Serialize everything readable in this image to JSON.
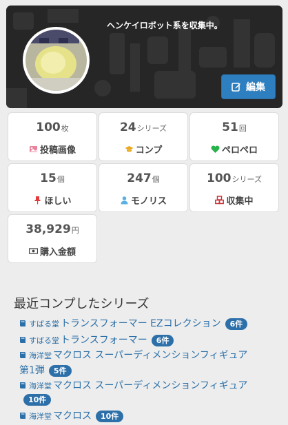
{
  "profile": {
    "bio": "ヘンケイロボット系を収集中。",
    "edit_label": "編集"
  },
  "stats": [
    {
      "value": "100",
      "unit": "枚",
      "label": "投稿画像",
      "icon": "image-icon",
      "icon_color": "#e9839b"
    },
    {
      "value": "24",
      "unit": "シリーズ",
      "label": "コンプ",
      "icon": "graduation-cap-icon",
      "icon_color": "#e8a91e"
    },
    {
      "value": "51",
      "unit": "回",
      "label": "ペロペロ",
      "icon": "heart-icon",
      "icon_color": "#27b24a"
    },
    {
      "value": "15",
      "unit": "個",
      "label": "ほしい",
      "icon": "pin-icon",
      "icon_color": "#e23b3b"
    },
    {
      "value": "247",
      "unit": "個",
      "label": "モノリス",
      "icon": "user-icon",
      "icon_color": "#5ab0e0"
    },
    {
      "value": "100",
      "unit": "シリーズ",
      "label": "収集中",
      "icon": "cubes-icon",
      "icon_color": "#c8353a"
    },
    {
      "value": "38,929",
      "unit": "円",
      "label": "購入金額",
      "icon": "money-icon",
      "icon_color": "#444444"
    }
  ],
  "recent": {
    "title": "最近コンプしたシリーズ",
    "items": [
      {
        "maker": "すばる堂",
        "name": "トランスフォーマー EZコレクション",
        "count": "6件"
      },
      {
        "maker": "すばる堂",
        "name": "トランスフォーマー",
        "count": "6件"
      },
      {
        "maker": "海洋堂",
        "name": "マクロス スーパーディメンションフィギュア",
        "name_cont": "第1弾",
        "count": "5件"
      },
      {
        "maker": "海洋堂",
        "name": "マクロス スーパーディメンションフィギュア",
        "count": "10件"
      },
      {
        "maker": "海洋堂",
        "name": "マクロス",
        "count": "10件"
      }
    ]
  },
  "colors": {
    "accent": "#2d7fbf",
    "banner": "#262626",
    "link": "#2a6fa8"
  }
}
